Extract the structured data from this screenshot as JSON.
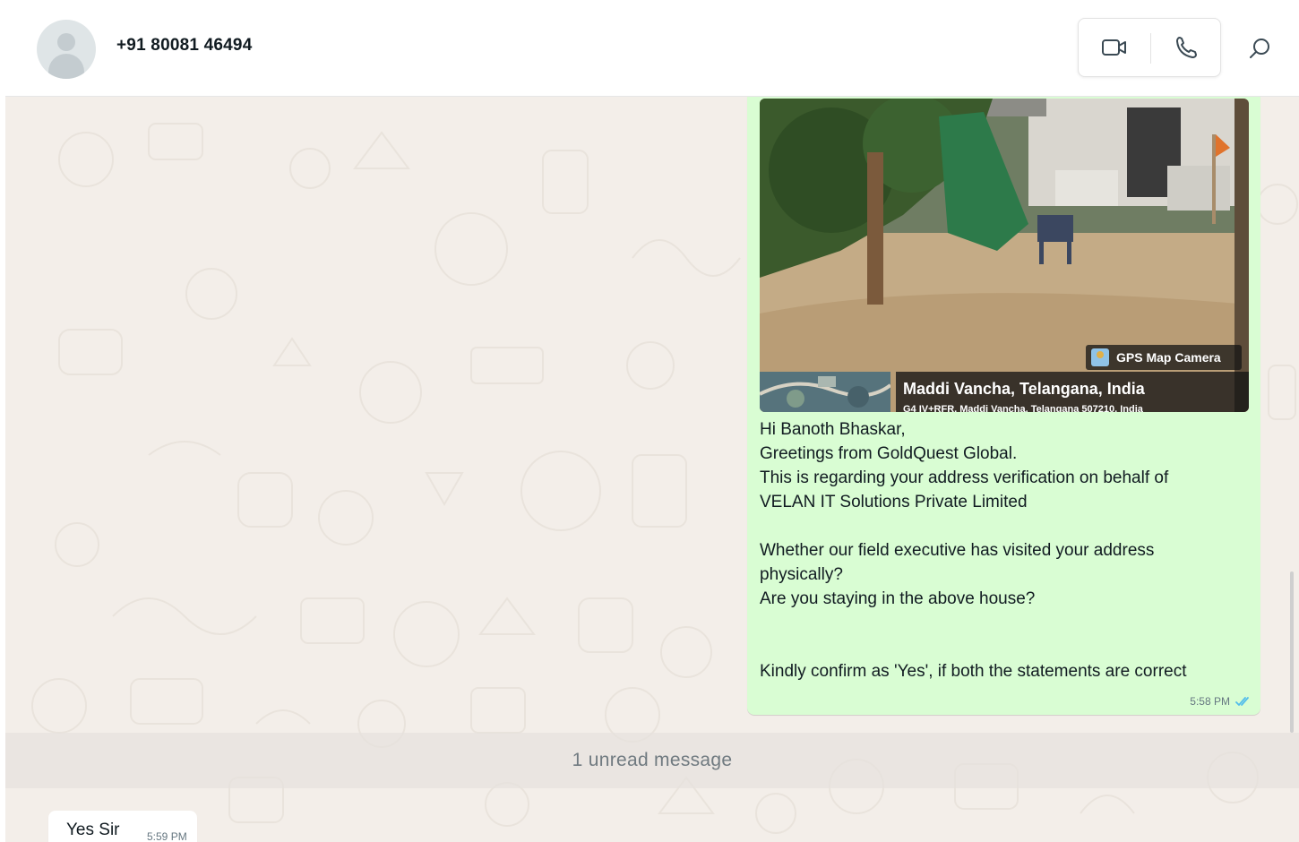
{
  "header": {
    "contact_name": "+91 80081 46494",
    "icons": {
      "avatar": "default-avatar",
      "video": "video-call-icon",
      "voice": "voice-call-icon",
      "search": "search-icon"
    }
  },
  "messages": {
    "outgoing": {
      "photo": {
        "overlay_badge": "GPS Map Camera",
        "location_title": "Maddi Vancha, Telangana, India",
        "location_subtitle": "G4 IV+RFR, Maddi Vancha, Telangana 507210, India"
      },
      "text": "Hi Banoth Bhaskar,\nGreetings from GoldQuest Global.\nThis is regarding your address verification on behalf of\nVELAN IT Solutions Private Limited\n\nWhether our field executive has visited your address\nphysically?\nAre you staying in the above house?\n\n\nKindly confirm as 'Yes', if both the statements are correct",
      "time": "5:58 PM",
      "status": "read-double-tick"
    },
    "unread_divider": "1 unread message",
    "incoming": {
      "text": "Yes Sir",
      "time": "5:59 PM"
    }
  },
  "colors": {
    "outgoing_bubble": "#d9fdd3",
    "incoming_bubble": "#ffffff",
    "chat_background": "#f3eee9",
    "read_tick": "#53bdeb"
  }
}
